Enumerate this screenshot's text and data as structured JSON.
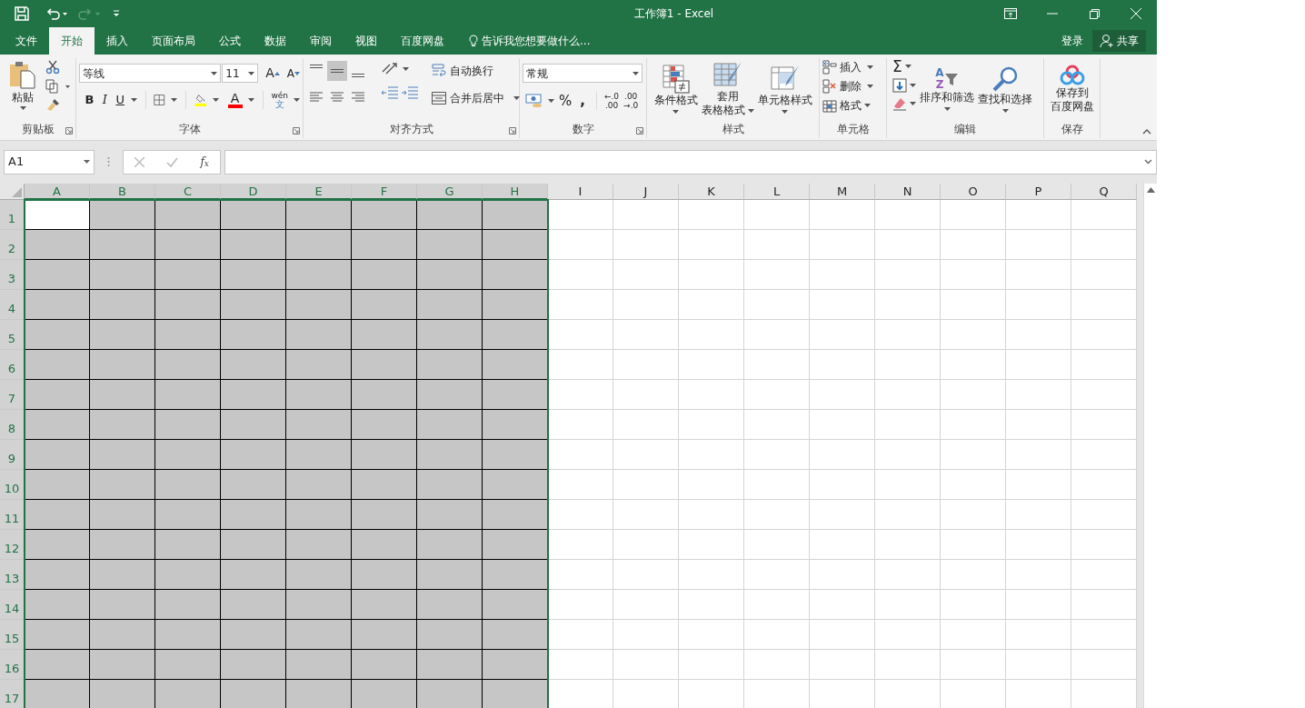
{
  "title_bar": {
    "title": "工作簿1 - Excel"
  },
  "ribbon_tabs": [
    {
      "label": "文件",
      "selected": false
    },
    {
      "label": "开始",
      "selected": true
    },
    {
      "label": "插入",
      "selected": false
    },
    {
      "label": "页面布局",
      "selected": false
    },
    {
      "label": "公式",
      "selected": false
    },
    {
      "label": "数据",
      "selected": false
    },
    {
      "label": "审阅",
      "selected": false
    },
    {
      "label": "视图",
      "selected": false
    },
    {
      "label": "百度网盘",
      "selected": false
    }
  ],
  "tell_me": "告诉我您想要做什么...",
  "account": {
    "sign_in": "登录",
    "share": "共享"
  },
  "clipboard": {
    "paste": "粘贴",
    "label": "剪贴板"
  },
  "font": {
    "name": "等线",
    "size": "11",
    "grow": "A",
    "shrink": "A",
    "bold": "B",
    "italic": "I",
    "underline": "U",
    "font_color_letter": "A",
    "phonetic": [
      "wén",
      "文"
    ],
    "label": "字体"
  },
  "alignment": {
    "vertical": [
      {
        "selected": false
      },
      {
        "selected": true
      },
      {
        "selected": false
      }
    ],
    "wrap_text": "自动换行",
    "merge": "合并后居中",
    "label": "对齐方式"
  },
  "number": {
    "format": "常规",
    "percent": "%",
    "comma": ",",
    "increase_decimal": [
      "←.0",
      ".00"
    ],
    "decrease_decimal": [
      ".00",
      "→.0"
    ],
    "label": "数字"
  },
  "styles": {
    "conditional": "条件格式",
    "table": [
      "套用",
      "表格格式"
    ],
    "cell_styles": "单元格样式",
    "label": "样式"
  },
  "cells": {
    "insert": "插入",
    "delete": "删除",
    "format": "格式",
    "label": "单元格"
  },
  "editing": {
    "autosum": "Σ",
    "sort_letters": [
      "A",
      "Z"
    ],
    "sort": "排序和筛选",
    "find": "查找和选择",
    "label": "编辑"
  },
  "save": {
    "button": [
      "保存到",
      "百度网盘"
    ],
    "label": "保存"
  },
  "formula_bar": {
    "name_box": "A1",
    "fx": "f$_{x}$"
  },
  "grid": {
    "columns": [
      {
        "label": "A",
        "selected": true
      },
      {
        "label": "B",
        "selected": true
      },
      {
        "label": "C",
        "selected": true
      },
      {
        "label": "D",
        "selected": true
      },
      {
        "label": "E",
        "selected": true
      },
      {
        "label": "F",
        "selected": true
      },
      {
        "label": "G",
        "selected": true
      },
      {
        "label": "H",
        "selected": true
      },
      {
        "label": "I",
        "selected": false
      },
      {
        "label": "J",
        "selected": false
      },
      {
        "label": "K",
        "selected": false
      },
      {
        "label": "L",
        "selected": false
      },
      {
        "label": "M",
        "selected": false
      },
      {
        "label": "N",
        "selected": false
      },
      {
        "label": "O",
        "selected": false
      },
      {
        "label": "P",
        "selected": false
      },
      {
        "label": "Q",
        "selected": false
      }
    ],
    "rows": [
      {
        "label": "1",
        "selected": true
      },
      {
        "label": "2",
        "selected": true
      },
      {
        "label": "3",
        "selected": true
      },
      {
        "label": "4",
        "selected": true
      },
      {
        "label": "5",
        "selected": true
      },
      {
        "label": "6",
        "selected": true
      },
      {
        "label": "7",
        "selected": true
      },
      {
        "label": "8",
        "selected": true
      },
      {
        "label": "9",
        "selected": true
      },
      {
        "label": "10",
        "selected": true
      },
      {
        "label": "11",
        "selected": true
      },
      {
        "label": "12",
        "selected": true
      },
      {
        "label": "13",
        "selected": true
      },
      {
        "label": "14",
        "selected": true
      },
      {
        "label": "15",
        "selected": true
      },
      {
        "label": "16",
        "selected": true
      },
      {
        "label": "17",
        "selected": true
      }
    ]
  }
}
